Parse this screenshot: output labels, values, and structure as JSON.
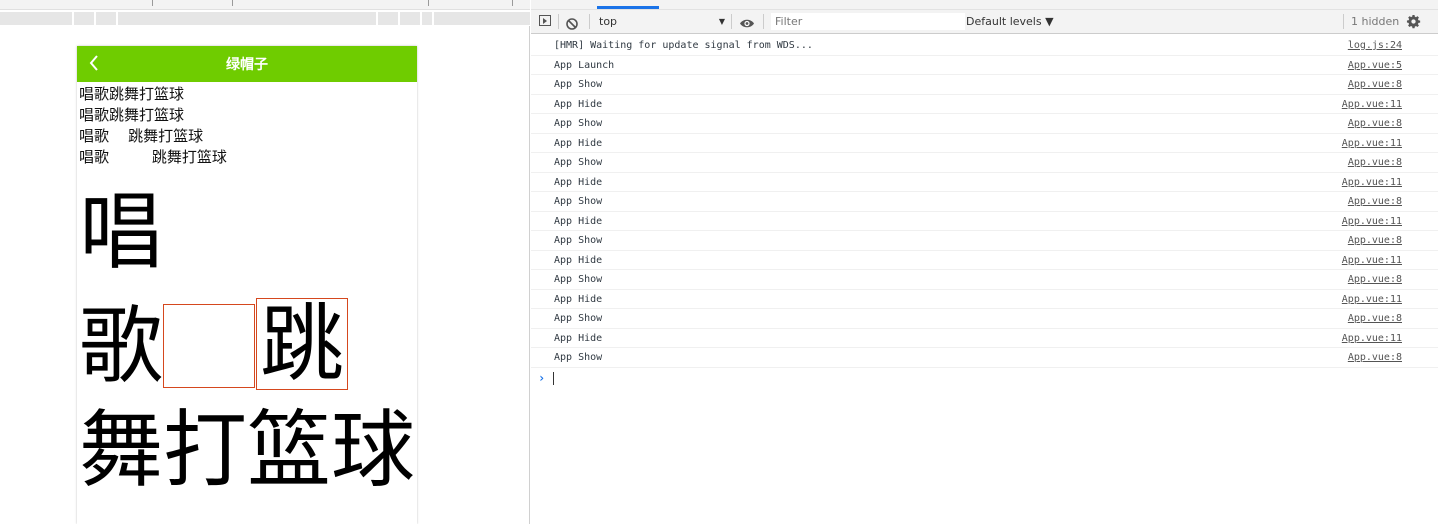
{
  "simulator": {
    "navbar": {
      "title": "绿帽子",
      "back_icon": "chevron-left-icon",
      "color": "#6fcc00"
    },
    "lines": [
      "唱歌跳舞打篮球",
      "唱歌跳舞打篮球",
      "唱歌    跳舞打篮球",
      "唱歌         跳舞打篮球"
    ],
    "big": {
      "chars": [
        "唱",
        "歌",
        "跳",
        "舞打篮球"
      ],
      "box_color": "#d5481e"
    }
  },
  "devtools": {
    "toolbar": {
      "sidebar_icon": "sidebar-toggle-icon",
      "clear_icon": "clear-console-icon",
      "context": "top",
      "eye_icon": "eye-icon",
      "filter_placeholder": "Filter",
      "levels": "Default levels ▼",
      "hidden": "1 hidden",
      "settings_icon": "gear-icon"
    },
    "logs": [
      {
        "msg": "[HMR] Waiting for update signal from WDS...",
        "src": "log.js:24"
      },
      {
        "msg": "App Launch",
        "src": "App.vue:5"
      },
      {
        "msg": "App Show",
        "src": "App.vue:8"
      },
      {
        "msg": "App Hide",
        "src": "App.vue:11"
      },
      {
        "msg": "App Show",
        "src": "App.vue:8"
      },
      {
        "msg": "App Hide",
        "src": "App.vue:11"
      },
      {
        "msg": "App Show",
        "src": "App.vue:8"
      },
      {
        "msg": "App Hide",
        "src": "App.vue:11"
      },
      {
        "msg": "App Show",
        "src": "App.vue:8"
      },
      {
        "msg": "App Hide",
        "src": "App.vue:11"
      },
      {
        "msg": "App Show",
        "src": "App.vue:8"
      },
      {
        "msg": "App Hide",
        "src": "App.vue:11"
      },
      {
        "msg": "App Show",
        "src": "App.vue:8"
      },
      {
        "msg": "App Hide",
        "src": "App.vue:11"
      },
      {
        "msg": "App Show",
        "src": "App.vue:8"
      },
      {
        "msg": "App Hide",
        "src": "App.vue:11"
      },
      {
        "msg": "App Show",
        "src": "App.vue:8"
      }
    ],
    "prompt": "›"
  }
}
